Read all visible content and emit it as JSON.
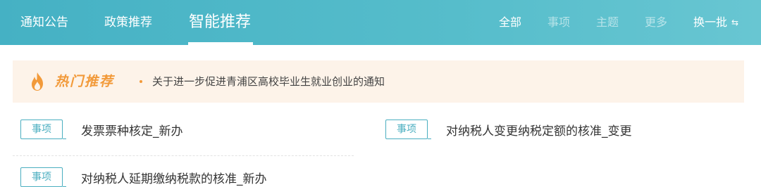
{
  "tabs": {
    "notice": "通知公告",
    "policy": "政策推荐",
    "smart": "智能推荐"
  },
  "filters": {
    "all": "全部",
    "matters": "事项",
    "topics": "主题",
    "more": "更多",
    "refresh": "换一批",
    "refresh_icon": "⇆"
  },
  "hot": {
    "title": "热门推荐",
    "link": "关于进一步促进青浦区高校毕业生就业创业的通知"
  },
  "items": [
    {
      "tag": "事项",
      "text": "发票票种核定_新办"
    },
    {
      "tag": "事项",
      "text": "对纳税人变更纳税定额的核准_变更"
    },
    {
      "tag": "事项",
      "text": "对纳税人延期缴纳税款的核准_新办"
    }
  ],
  "colors": {
    "header": "#4fb8c8",
    "accent": "#4aaec0",
    "hot": "#f29a3a",
    "hot_bg": "#fdf3e9"
  }
}
